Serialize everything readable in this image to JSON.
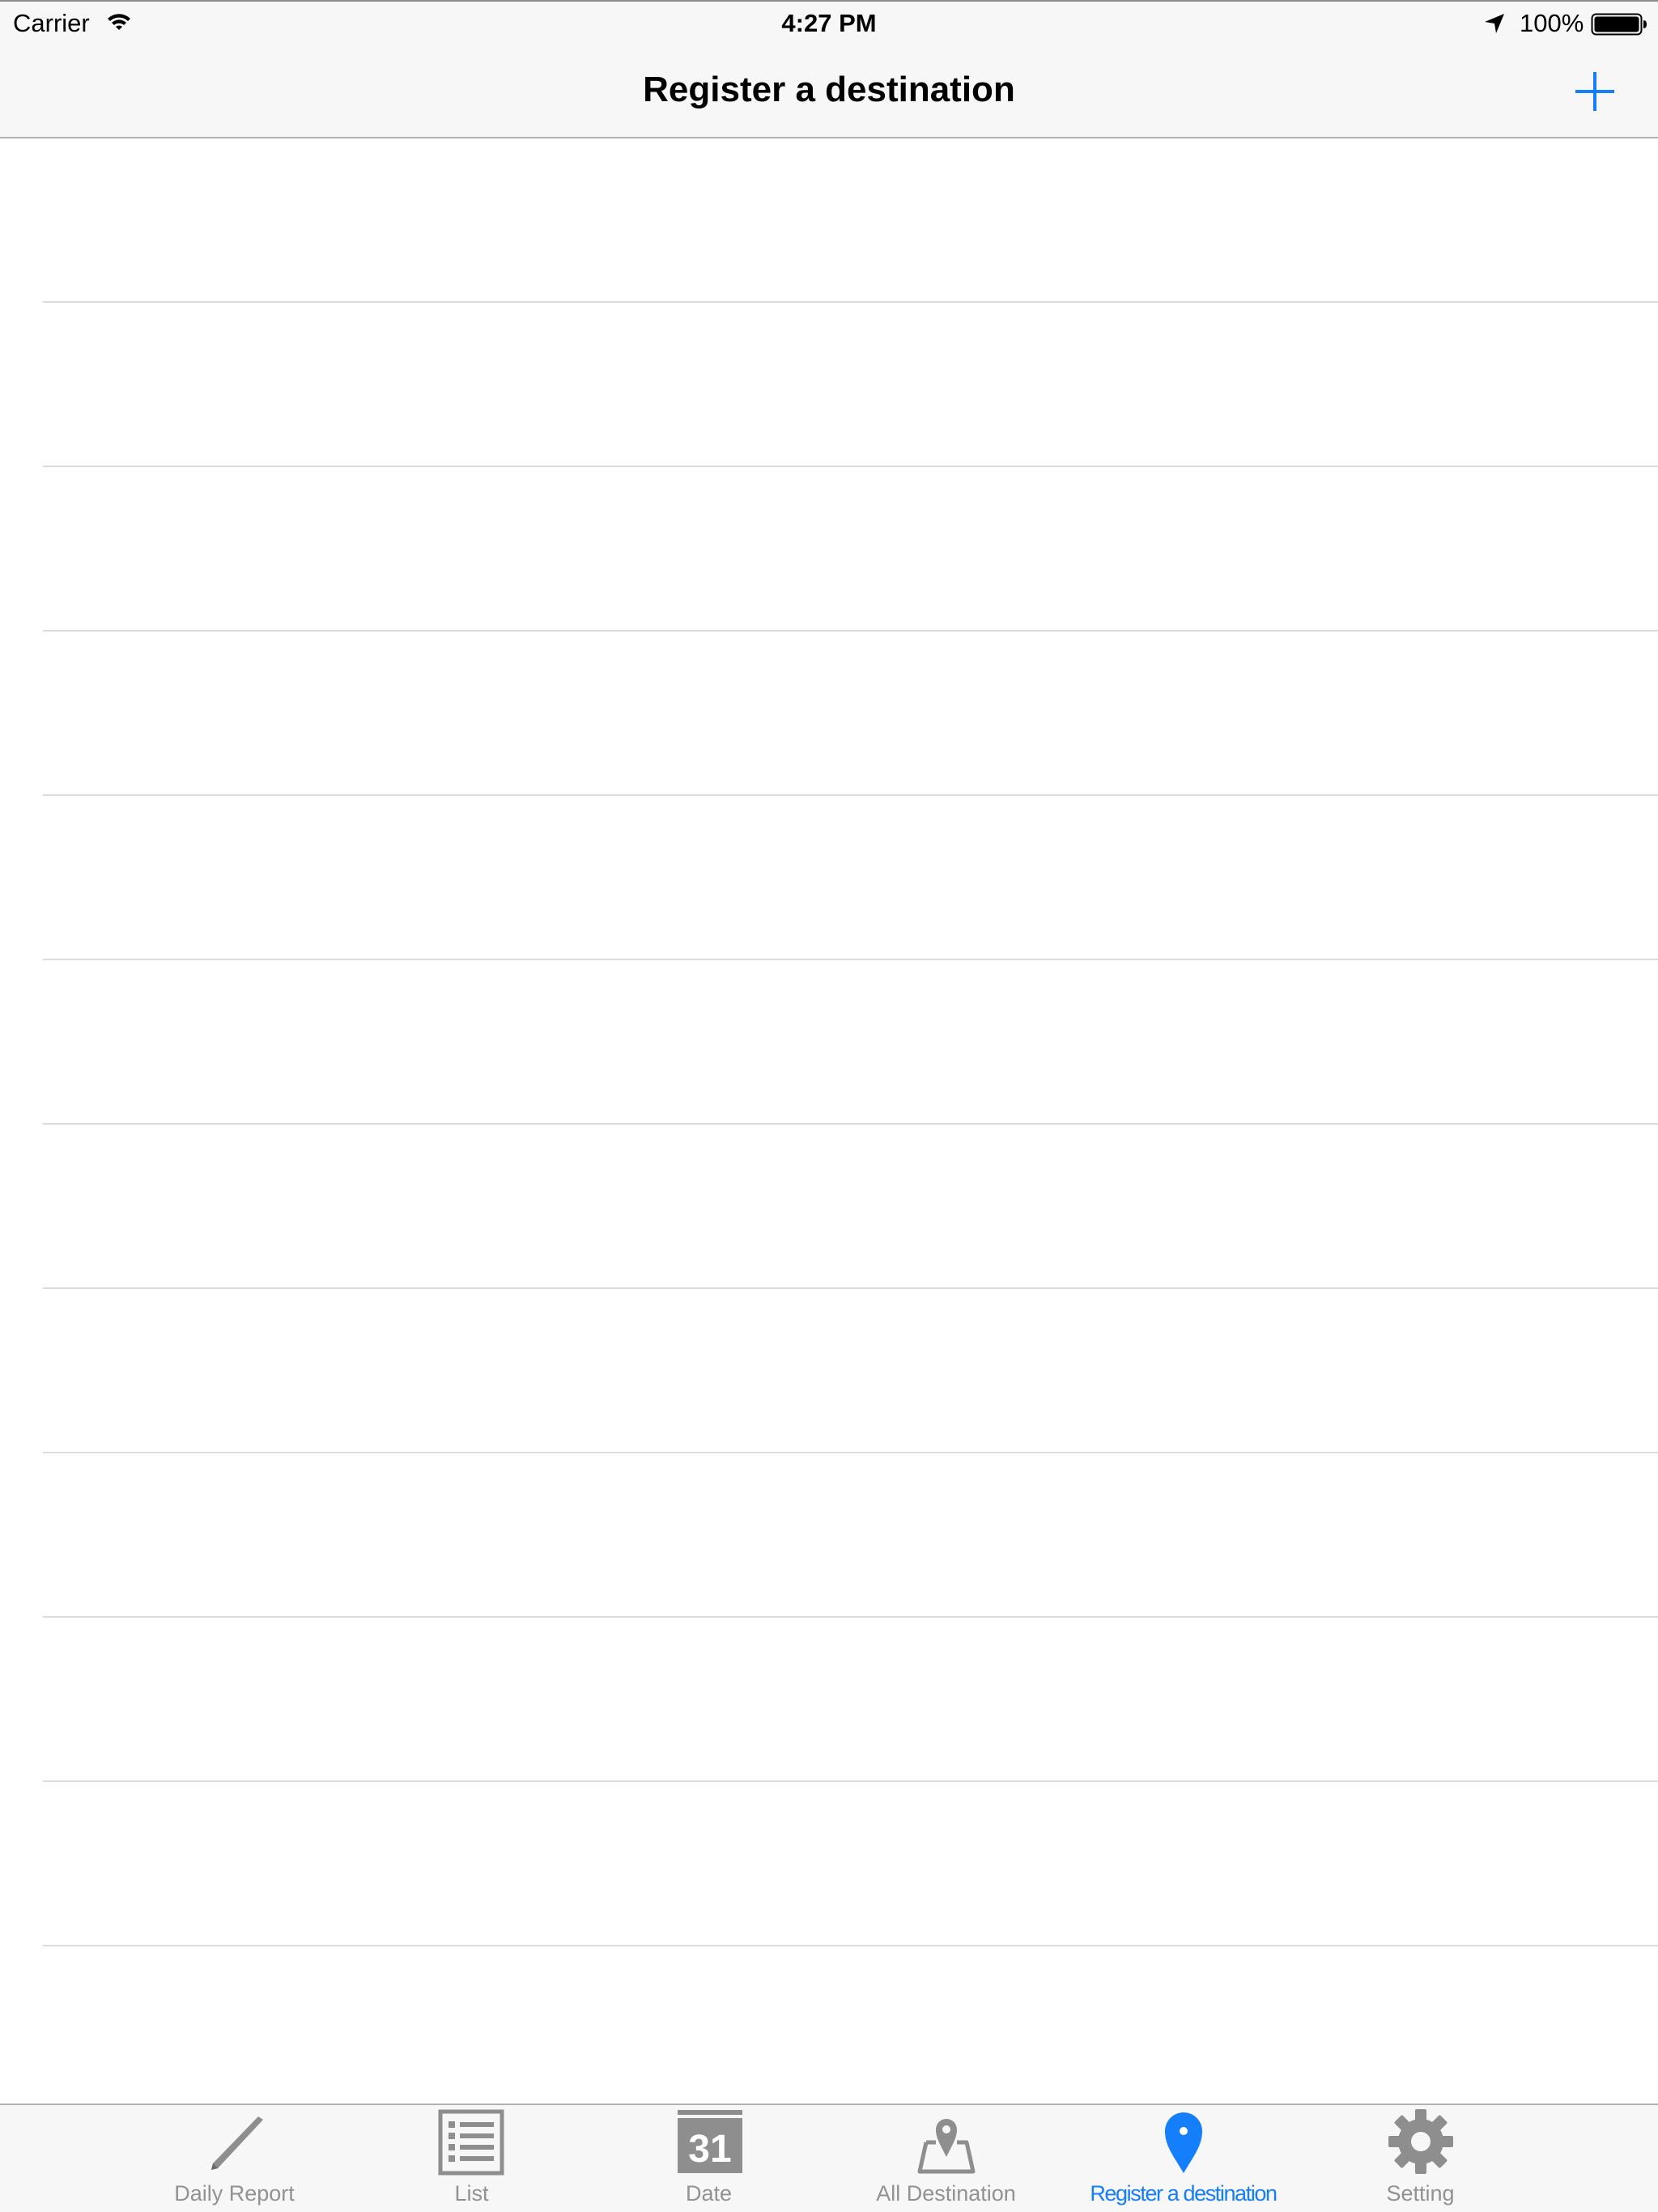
{
  "status_bar": {
    "carrier": "Carrier",
    "time": "4:27 PM",
    "battery": "100%",
    "icons": [
      "wifi-icon",
      "location-arrow-icon",
      "battery-icon"
    ]
  },
  "nav_bar": {
    "title": "Register a destination",
    "add_icon": "plus-icon"
  },
  "table": {
    "rows": [
      "",
      "",
      "",
      "",
      "",
      "",
      "",
      "",
      "",
      "",
      "",
      ""
    ]
  },
  "tab_bar": {
    "items": [
      {
        "label": "Daily Report",
        "icon": "pencil-icon",
        "active": false
      },
      {
        "label": "List",
        "icon": "list-icon",
        "active": false
      },
      {
        "label": "Date",
        "icon": "calendar-icon",
        "active": false
      },
      {
        "label": "All Destination",
        "icon": "map-pin-icon",
        "active": false
      },
      {
        "label": "Register a destination",
        "icon": "location-marker-icon",
        "active": true
      },
      {
        "label": "Setting",
        "icon": "gear-icon",
        "active": false
      }
    ],
    "calendar_day": "31"
  },
  "colors": {
    "accent": "#157efb",
    "inactive": "#929292",
    "bar_background": "#f7f7f7",
    "separator": "#dcdcdc"
  }
}
